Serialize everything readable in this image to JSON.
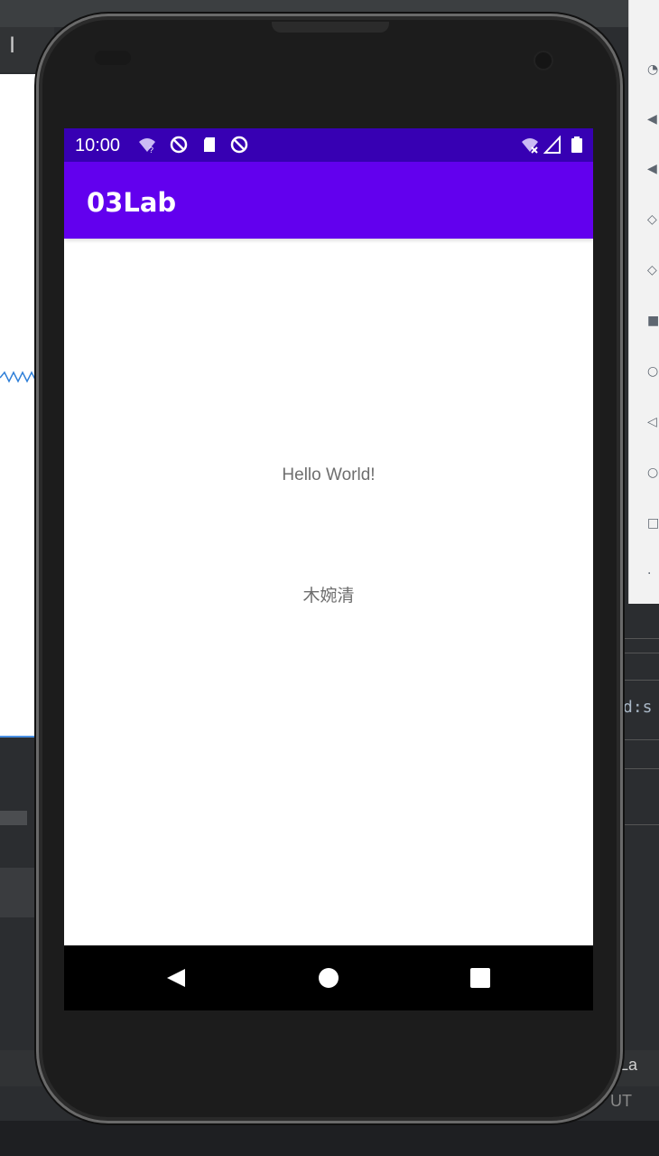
{
  "ide": {
    "toolbar_glyph": "I",
    "code_fragment": "d:s",
    "bottom_label_1": "La",
    "bottom_label_2": "F  UT"
  },
  "device": {
    "status_bar": {
      "time": "10:00",
      "icons": [
        "wifi-question-icon",
        "blocked-icon",
        "sd-card-icon",
        "blocked-icon",
        "wifi-off-icon",
        "signal-icon",
        "battery-icon"
      ]
    },
    "app_bar": {
      "title": "03Lab"
    },
    "content": {
      "text_1": "Hello World!",
      "text_2": "木婉清"
    },
    "navigation": {
      "back": "back-button",
      "home": "home-button",
      "recents": "recents-button"
    }
  },
  "colors": {
    "status_bar": "#3700b3",
    "app_bar": "#6200ee",
    "content_text": "#6e6e6e",
    "nav_bar": "#000000"
  }
}
